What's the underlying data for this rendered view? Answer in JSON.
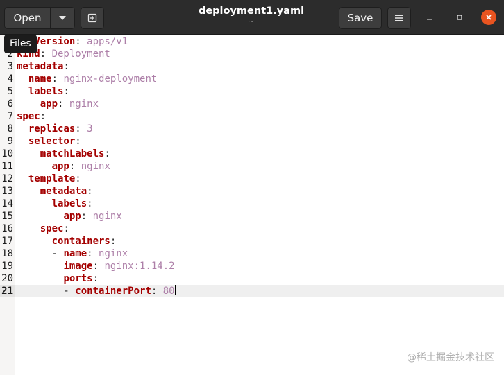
{
  "header": {
    "open_label": "Open",
    "save_label": "Save",
    "title": "deployment1.yaml",
    "subtitle": "~",
    "accent_close_color": "#e95420"
  },
  "tooltip": "Files",
  "editor": {
    "current_line": 21,
    "lines": [
      {
        "n": "1",
        "indent": "",
        "key": "apiVersion",
        "sep": ": ",
        "value": "apps/v1"
      },
      {
        "n": "2",
        "indent": "",
        "key": "kind",
        "sep": ": ",
        "value": "Deployment"
      },
      {
        "n": "3",
        "indent": "",
        "key": "metadata",
        "sep": ":",
        "value": ""
      },
      {
        "n": "4",
        "indent": "  ",
        "key": "name",
        "sep": ": ",
        "value": "nginx-deployment"
      },
      {
        "n": "5",
        "indent": "  ",
        "key": "labels",
        "sep": ":",
        "value": ""
      },
      {
        "n": "6",
        "indent": "    ",
        "key": "app",
        "sep": ": ",
        "value": "nginx"
      },
      {
        "n": "7",
        "indent": "",
        "key": "spec",
        "sep": ":",
        "value": ""
      },
      {
        "n": "8",
        "indent": "  ",
        "key": "replicas",
        "sep": ": ",
        "value": "3"
      },
      {
        "n": "9",
        "indent": "  ",
        "key": "selector",
        "sep": ":",
        "value": ""
      },
      {
        "n": "10",
        "indent": "    ",
        "key": "matchLabels",
        "sep": ":",
        "value": ""
      },
      {
        "n": "11",
        "indent": "      ",
        "key": "app",
        "sep": ": ",
        "value": "nginx"
      },
      {
        "n": "12",
        "indent": "  ",
        "key": "template",
        "sep": ":",
        "value": ""
      },
      {
        "n": "13",
        "indent": "    ",
        "key": "metadata",
        "sep": ":",
        "value": ""
      },
      {
        "n": "14",
        "indent": "      ",
        "key": "labels",
        "sep": ":",
        "value": ""
      },
      {
        "n": "15",
        "indent": "        ",
        "key": "app",
        "sep": ": ",
        "value": "nginx"
      },
      {
        "n": "16",
        "indent": "    ",
        "key": "spec",
        "sep": ":",
        "value": ""
      },
      {
        "n": "17",
        "indent": "      ",
        "key": "containers",
        "sep": ":",
        "value": ""
      },
      {
        "n": "18",
        "indent": "      - ",
        "key": "name",
        "sep": ": ",
        "value": "nginx"
      },
      {
        "n": "19",
        "indent": "        ",
        "key": "image",
        "sep": ": ",
        "value": "nginx:1.14.2"
      },
      {
        "n": "20",
        "indent": "        ",
        "key": "ports",
        "sep": ":",
        "value": ""
      },
      {
        "n": "21",
        "indent": "        - ",
        "key": "containerPort",
        "sep": ": ",
        "value": "80"
      }
    ]
  },
  "watermark": "@稀土掘金技术社区"
}
